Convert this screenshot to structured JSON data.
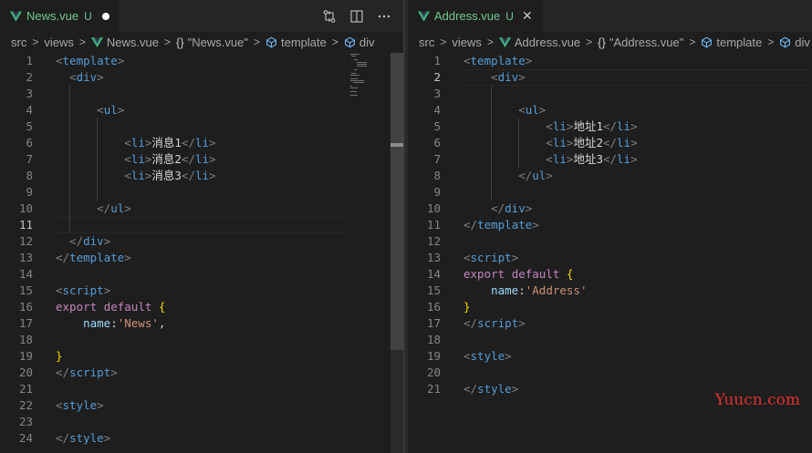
{
  "colors": {
    "vue_icon": "#41b883",
    "modified_text": "#73c991",
    "editor_background": "#1e1e1e",
    "watermark": "#e0312f"
  },
  "left_editor": {
    "tab": {
      "title": "News.vue",
      "badge": "U",
      "dirty_indicator_icon": "circle-filled-icon"
    },
    "actions": [
      "source-control-compare-icon",
      "split-editor-icon",
      "more-actions-icon"
    ],
    "breadcrumb": {
      "folder_1": "src",
      "folder_2": "views",
      "file": "News.vue",
      "braces": "{}",
      "component": "\"News.vue\"",
      "node_1": "template",
      "node_2": "div"
    },
    "active_line": 11,
    "lines": [
      {
        "n": "1",
        "tokens": [
          [
            "p",
            "<"
          ],
          [
            "tag",
            "template"
          ],
          [
            "p",
            ">"
          ]
        ]
      },
      {
        "n": "2",
        "tokens": [
          [
            "p",
            "  <"
          ],
          [
            "tag",
            "div"
          ],
          [
            "p",
            ">"
          ]
        ]
      },
      {
        "n": "3",
        "tokens": []
      },
      {
        "n": "4",
        "tokens": [
          [
            "p",
            "      <"
          ],
          [
            "tag",
            "ul"
          ],
          [
            "p",
            ">"
          ]
        ]
      },
      {
        "n": "5",
        "tokens": []
      },
      {
        "n": "6",
        "tokens": [
          [
            "p",
            "          <"
          ],
          [
            "tag",
            "li"
          ],
          [
            "p",
            ">"
          ],
          [
            "txt",
            "消息1"
          ],
          [
            "p",
            "</"
          ],
          [
            "tag",
            "li"
          ],
          [
            "p",
            ">"
          ]
        ]
      },
      {
        "n": "7",
        "tokens": [
          [
            "p",
            "          <"
          ],
          [
            "tag",
            "li"
          ],
          [
            "p",
            ">"
          ],
          [
            "txt",
            "消息2"
          ],
          [
            "p",
            "</"
          ],
          [
            "tag",
            "li"
          ],
          [
            "p",
            ">"
          ]
        ]
      },
      {
        "n": "8",
        "tokens": [
          [
            "p",
            "          <"
          ],
          [
            "tag",
            "li"
          ],
          [
            "p",
            ">"
          ],
          [
            "txt",
            "消息3"
          ],
          [
            "p",
            "</"
          ],
          [
            "tag",
            "li"
          ],
          [
            "p",
            ">"
          ]
        ]
      },
      {
        "n": "9",
        "tokens": []
      },
      {
        "n": "10",
        "tokens": [
          [
            "p",
            "      </"
          ],
          [
            "tag",
            "ul"
          ],
          [
            "p",
            ">"
          ]
        ]
      },
      {
        "n": "11",
        "tokens": []
      },
      {
        "n": "12",
        "tokens": [
          [
            "p",
            "  </"
          ],
          [
            "tag",
            "div"
          ],
          [
            "p",
            ">"
          ]
        ]
      },
      {
        "n": "13",
        "tokens": [
          [
            "p",
            "</"
          ],
          [
            "tag",
            "template"
          ],
          [
            "p",
            ">"
          ]
        ]
      },
      {
        "n": "14",
        "tokens": []
      },
      {
        "n": "15",
        "tokens": [
          [
            "p",
            "<"
          ],
          [
            "tag",
            "script"
          ],
          [
            "p",
            ">"
          ]
        ]
      },
      {
        "n": "16",
        "tokens": [
          [
            "kw",
            "export"
          ],
          [
            "txt",
            " "
          ],
          [
            "kw",
            "default"
          ],
          [
            "txt",
            " "
          ],
          [
            "br",
            "{"
          ]
        ]
      },
      {
        "n": "17",
        "tokens": [
          [
            "txt",
            "    "
          ],
          [
            "prop",
            "name"
          ],
          [
            "txt",
            ":"
          ],
          [
            "str",
            "'News'"
          ],
          [
            "txt",
            ","
          ]
        ]
      },
      {
        "n": "18",
        "tokens": []
      },
      {
        "n": "19",
        "tokens": [
          [
            "br",
            "}"
          ]
        ]
      },
      {
        "n": "20",
        "tokens": [
          [
            "p",
            "</"
          ],
          [
            "tag",
            "script"
          ],
          [
            "p",
            ">"
          ]
        ]
      },
      {
        "n": "21",
        "tokens": []
      },
      {
        "n": "22",
        "tokens": [
          [
            "p",
            "<"
          ],
          [
            "tag",
            "style"
          ],
          [
            "p",
            ">"
          ]
        ]
      },
      {
        "n": "23",
        "tokens": []
      },
      {
        "n": "24",
        "tokens": [
          [
            "p",
            "</"
          ],
          [
            "tag",
            "style"
          ],
          [
            "p",
            ">"
          ]
        ]
      }
    ]
  },
  "right_editor": {
    "tab": {
      "title": "Address.vue",
      "badge": "U",
      "close_icon": "close-icon"
    },
    "breadcrumb": {
      "folder_1": "src",
      "folder_2": "views",
      "file": "Address.vue",
      "braces": "{}",
      "component": "\"Address.vue\"",
      "node_1": "template",
      "node_2": "div"
    },
    "active_line": 2,
    "lines": [
      {
        "n": "1",
        "tokens": [
          [
            "p",
            "<"
          ],
          [
            "tag",
            "template"
          ],
          [
            "p",
            ">"
          ]
        ]
      },
      {
        "n": "2",
        "tokens": [
          [
            "p",
            "    <"
          ],
          [
            "tag",
            "div"
          ],
          [
            "p",
            ">"
          ]
        ]
      },
      {
        "n": "3",
        "tokens": []
      },
      {
        "n": "4",
        "tokens": [
          [
            "p",
            "        <"
          ],
          [
            "tag",
            "ul"
          ],
          [
            "p",
            ">"
          ]
        ]
      },
      {
        "n": "5",
        "tokens": [
          [
            "p",
            "            <"
          ],
          [
            "tag",
            "li"
          ],
          [
            "p",
            ">"
          ],
          [
            "txt",
            "地址1"
          ],
          [
            "p",
            "</"
          ],
          [
            "tag",
            "li"
          ],
          [
            "p",
            ">"
          ]
        ]
      },
      {
        "n": "6",
        "tokens": [
          [
            "p",
            "            <"
          ],
          [
            "tag",
            "li"
          ],
          [
            "p",
            ">"
          ],
          [
            "txt",
            "地址2"
          ],
          [
            "p",
            "</"
          ],
          [
            "tag",
            "li"
          ],
          [
            "p",
            ">"
          ]
        ]
      },
      {
        "n": "7",
        "tokens": [
          [
            "p",
            "            <"
          ],
          [
            "tag",
            "li"
          ],
          [
            "p",
            ">"
          ],
          [
            "txt",
            "地址3"
          ],
          [
            "p",
            "</"
          ],
          [
            "tag",
            "li"
          ],
          [
            "p",
            ">"
          ]
        ]
      },
      {
        "n": "8",
        "tokens": [
          [
            "p",
            "        </"
          ],
          [
            "tag",
            "ul"
          ],
          [
            "p",
            ">"
          ]
        ]
      },
      {
        "n": "9",
        "tokens": []
      },
      {
        "n": "10",
        "tokens": [
          [
            "p",
            "    </"
          ],
          [
            "tag",
            "div"
          ],
          [
            "p",
            ">"
          ]
        ]
      },
      {
        "n": "11",
        "tokens": [
          [
            "p",
            "</"
          ],
          [
            "tag",
            "template"
          ],
          [
            "p",
            ">"
          ]
        ]
      },
      {
        "n": "12",
        "tokens": []
      },
      {
        "n": "13",
        "tokens": [
          [
            "p",
            "<"
          ],
          [
            "tag",
            "script"
          ],
          [
            "p",
            ">"
          ]
        ]
      },
      {
        "n": "14",
        "tokens": [
          [
            "kw",
            "export"
          ],
          [
            "txt",
            " "
          ],
          [
            "kw",
            "default"
          ],
          [
            "txt",
            " "
          ],
          [
            "br",
            "{"
          ]
        ]
      },
      {
        "n": "15",
        "tokens": [
          [
            "txt",
            "    "
          ],
          [
            "prop",
            "name"
          ],
          [
            "txt",
            ":"
          ],
          [
            "str",
            "'Address'"
          ]
        ]
      },
      {
        "n": "16",
        "tokens": [
          [
            "br",
            "}"
          ]
        ]
      },
      {
        "n": "17",
        "tokens": [
          [
            "p",
            "</"
          ],
          [
            "tag",
            "script"
          ],
          [
            "p",
            ">"
          ]
        ]
      },
      {
        "n": "18",
        "tokens": []
      },
      {
        "n": "19",
        "tokens": [
          [
            "p",
            "<"
          ],
          [
            "tag",
            "style"
          ],
          [
            "p",
            ">"
          ]
        ]
      },
      {
        "n": "20",
        "tokens": []
      },
      {
        "n": "21",
        "tokens": [
          [
            "p",
            "</"
          ],
          [
            "tag",
            "style"
          ],
          [
            "p",
            ">"
          ]
        ]
      }
    ]
  },
  "watermark": "Yuucn.com"
}
